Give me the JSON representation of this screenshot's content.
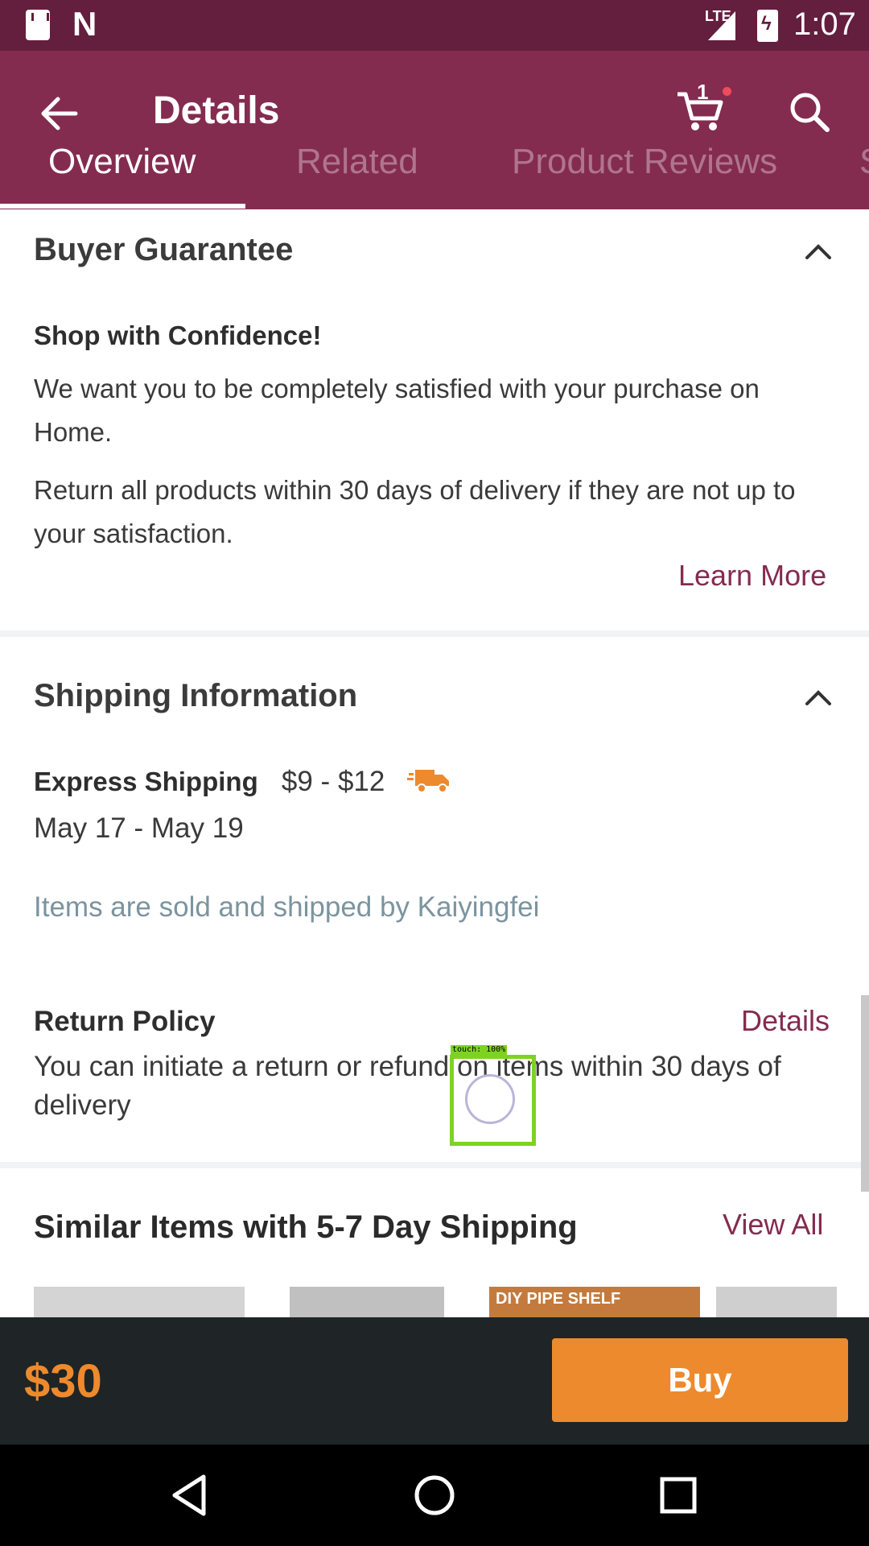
{
  "status_bar": {
    "network": "LTE",
    "time": "1:07"
  },
  "app_bar": {
    "title": "Details",
    "cart_count": "1",
    "icons": {
      "back": "back-arrow-icon",
      "cart": "cart-icon",
      "search": "search-icon"
    }
  },
  "tabs": [
    {
      "label": "Overview",
      "active": true
    },
    {
      "label": "Related",
      "active": false
    },
    {
      "label": "Product Reviews",
      "active": false
    },
    {
      "label": "S",
      "active": false
    }
  ],
  "buyer_guarantee": {
    "title": "Buyer Guarantee",
    "heading": "Shop with Confidence!",
    "text1": "We want you to be completely satisfied with your purchase on Home.",
    "text2": "Return all products within 30 days of delivery if they are not up to your satisfaction.",
    "learn_more": "Learn More"
  },
  "shipping": {
    "title": "Shipping Information",
    "method": "Express Shipping",
    "price": "$9 - $12",
    "dates": "May 17 - May 19",
    "seller_note": "Items are sold and shipped by Kaiyingfei"
  },
  "return_policy": {
    "title": "Return Policy",
    "details_link": "Details",
    "text": "You can initiate a return or refund on items within 30 days of delivery"
  },
  "similar": {
    "title": "Similar Items with 5-7 Day Shipping",
    "view_all": "View All",
    "thumb_text": "DIY PIPE SHELF"
  },
  "touch_indicator": {
    "label": "touch: 100%"
  },
  "bottom_bar": {
    "price": "$30",
    "buy_label": "Buy"
  },
  "colors": {
    "brand": "#842b50",
    "status": "#641e3e",
    "accent": "#ed8a2d",
    "muted": "#7b949f"
  }
}
